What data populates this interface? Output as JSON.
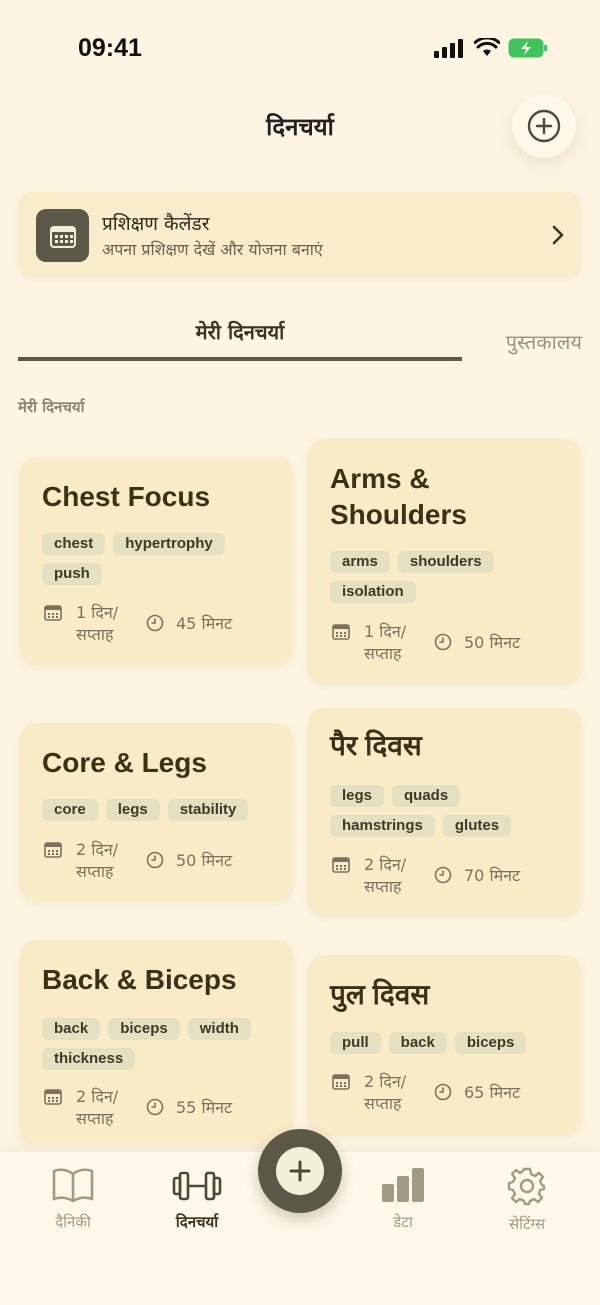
{
  "status": {
    "time": "09:41"
  },
  "header": {
    "title": "दिनचर्या"
  },
  "calendar_banner": {
    "title": "प्रशिक्षण कैलेंडर",
    "subtitle": "अपना प्रशिक्षण देखें और योजना बनाएं"
  },
  "tabs": [
    {
      "label": "मेरी दिनचर्या",
      "active": true
    },
    {
      "label": "पुस्तकालय",
      "active": false
    }
  ],
  "section_label": "मेरी दिनचर्या",
  "routines": [
    {
      "title": "Chest Focus",
      "tags": [
        "chest",
        "hypertrophy",
        "push"
      ],
      "days": "1 दिन/",
      "per_week": "सप्ताह",
      "minutes": "45 मिनट"
    },
    {
      "title_line1": "Arms &",
      "title_line2": "Shoulders",
      "tags": [
        "arms",
        "shoulders",
        "isolation"
      ],
      "days": "1 दिन/",
      "per_week": "सप्ताह",
      "minutes": "50 मिनट"
    },
    {
      "title": "Core & Legs",
      "tags": [
        "core",
        "legs",
        "stability"
      ],
      "days": "2 दिन/",
      "per_week": "सप्ताह",
      "minutes": "50 मिनट"
    },
    {
      "title": "पैर दिवस",
      "tags": [
        "legs",
        "quads",
        "hamstrings",
        "glutes"
      ],
      "days": "2 दिन/",
      "per_week": "सप्ताह",
      "minutes": "70 मिनट"
    },
    {
      "title": "Back & Biceps",
      "tags": [
        "back",
        "biceps",
        "width",
        "thickness"
      ],
      "days": "2 दिन/",
      "per_week": "सप्ताह",
      "minutes": "55 मिनट"
    },
    {
      "title": "पुल दिवस",
      "tags": [
        "pull",
        "back",
        "biceps"
      ],
      "days": "2 दिन/",
      "per_week": "सप्ताह",
      "minutes": "65 मिनट"
    }
  ],
  "nav": [
    {
      "label": "दैनिकी",
      "icon": "book-icon",
      "active": false
    },
    {
      "label": "दिनचर्या",
      "icon": "dumbbell-icon",
      "active": true
    },
    {
      "label": "डेटा",
      "icon": "bar-chart-icon",
      "active": false
    },
    {
      "label": "सेटिंग्स",
      "icon": "gear-icon",
      "active": false
    }
  ],
  "colors": {
    "background": "#fdf5e2",
    "card": "#f9ebc6",
    "accent": "#5b5a48",
    "tag": "#e4e1c3"
  }
}
